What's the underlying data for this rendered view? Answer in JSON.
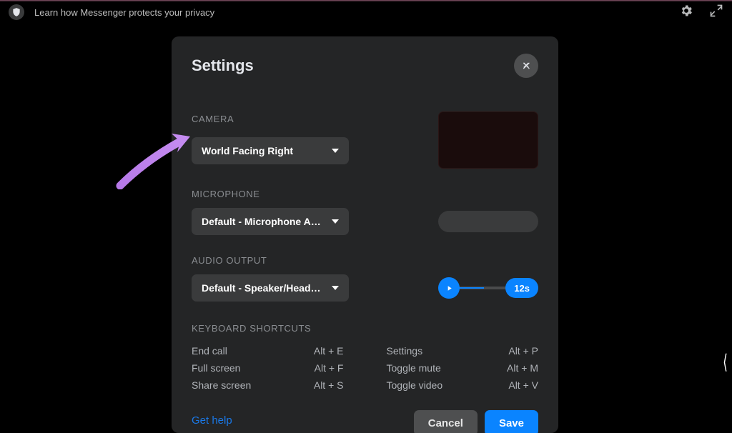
{
  "topbar": {
    "hint": "Learn how Messenger protects your privacy"
  },
  "modal": {
    "title": "Settings",
    "camera": {
      "label": "CAMERA",
      "selected": "World Facing Right"
    },
    "microphone": {
      "label": "MICROPHONE",
      "selected": "Default - Microphone Ar…"
    },
    "audio_output": {
      "label": "AUDIO OUTPUT",
      "selected": "Default - Speaker/Headp…",
      "preview_time": "12s"
    },
    "keyboard": {
      "label": "KEYBOARD SHORTCUTS",
      "left": [
        {
          "name": "End call",
          "keys": "Alt + E"
        },
        {
          "name": "Full screen",
          "keys": "Alt + F"
        },
        {
          "name": "Share screen",
          "keys": "Alt + S"
        }
      ],
      "right": [
        {
          "name": "Settings",
          "keys": "Alt + P"
        },
        {
          "name": "Toggle mute",
          "keys": "Alt + M"
        },
        {
          "name": "Toggle video",
          "keys": "Alt + V"
        }
      ]
    },
    "footer": {
      "help": "Get help",
      "cancel": "Cancel",
      "save": "Save"
    }
  }
}
